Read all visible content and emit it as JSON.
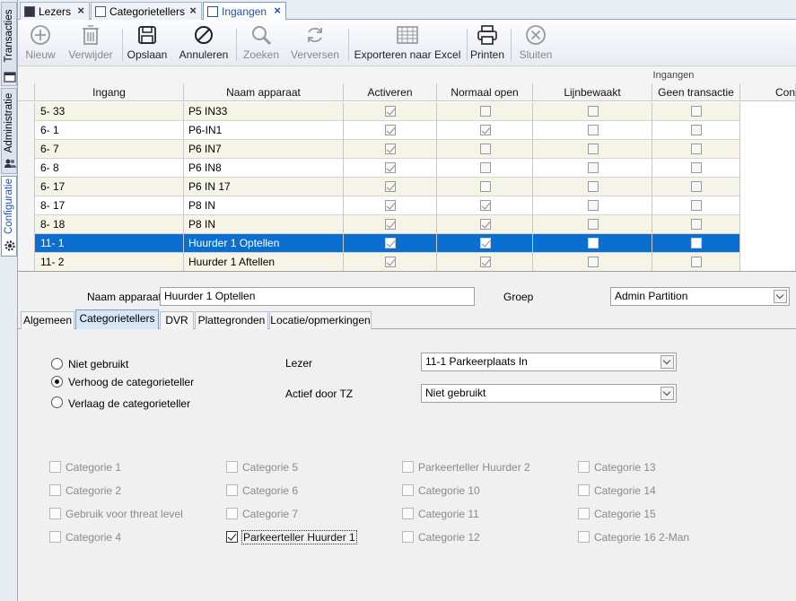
{
  "vertical_tabs": [
    {
      "label": "Transacties",
      "icon": "window-icon"
    },
    {
      "label": "Administratie",
      "icon": "users-icon"
    },
    {
      "label": "Configuratie",
      "icon": "gear-icon"
    }
  ],
  "doc_tabs": [
    {
      "label": "Lezers",
      "icon": "reader-icon"
    },
    {
      "label": "Categorietellers",
      "icon": "counter-icon"
    },
    {
      "label": "Ingangen",
      "icon": "entrance-icon"
    }
  ],
  "toolbar": {
    "nieuw": "Nieuw",
    "verwijder": "Verwijder",
    "opslaan": "Opslaan",
    "annuleren": "Annuleren",
    "zoeken": "Zoeken",
    "verversen": "Verversen",
    "exporteren": "Exporteren naar Excel",
    "printen": "Printen",
    "sluiten": "Sluiten"
  },
  "grid": {
    "group_header": "Ingangen",
    "columns": [
      "Ingang",
      "Naam apparaat",
      "Activeren",
      "Normaal open",
      "Lijnbewaakt",
      "Geen transactie",
      "Con"
    ],
    "rows": [
      {
        "ingang": "5- 33",
        "naam": "P5 IN33",
        "activeren": true,
        "normaal_open": false,
        "lijnbewaakt": false,
        "geen_transactie": false
      },
      {
        "ingang": "6- 1",
        "naam": "P6-IN1",
        "activeren": true,
        "normaal_open": true,
        "lijnbewaakt": false,
        "geen_transactie": false
      },
      {
        "ingang": "6- 7",
        "naam": "P6 IN7",
        "activeren": true,
        "normaal_open": false,
        "lijnbewaakt": false,
        "geen_transactie": false
      },
      {
        "ingang": "6- 8",
        "naam": "P6 IN8",
        "activeren": true,
        "normaal_open": false,
        "lijnbewaakt": false,
        "geen_transactie": false
      },
      {
        "ingang": "6- 17",
        "naam": "P6 IN 17",
        "activeren": true,
        "normaal_open": false,
        "lijnbewaakt": false,
        "geen_transactie": false
      },
      {
        "ingang": "8- 17",
        "naam": "P8 IN",
        "activeren": true,
        "normaal_open": true,
        "lijnbewaakt": false,
        "geen_transactie": false
      },
      {
        "ingang": "8- 18",
        "naam": "P8 IN",
        "activeren": true,
        "normaal_open": true,
        "lijnbewaakt": false,
        "geen_transactie": false
      },
      {
        "ingang": "11- 1",
        "naam": "Huurder 1 Optellen",
        "activeren": true,
        "normaal_open": true,
        "lijnbewaakt": false,
        "geen_transactie": false,
        "selected": true
      },
      {
        "ingang": "11- 2",
        "naam": "Huurder 1 Aftellen",
        "activeren": true,
        "normaal_open": true,
        "lijnbewaakt": false,
        "geen_transactie": false
      }
    ]
  },
  "detail": {
    "naam_label": "Naam apparaat",
    "naam_value": "Huurder 1 Optellen",
    "groep_label": "Groep",
    "groep_value": "Admin Partition"
  },
  "subtabs": [
    "Algemeen",
    "Categorietellers",
    "DVR",
    "Plattegronden",
    "Locatie/opmerkingen"
  ],
  "categorie": {
    "radios": [
      {
        "label": "Niet gebruikt",
        "checked": false
      },
      {
        "label": "Verhoog de categorieteller",
        "checked": true
      },
      {
        "label": "Verlaag de categorieteller",
        "checked": false
      }
    ],
    "lezer_label": "Lezer",
    "lezer_value": "11-1 Parkeerplaats In",
    "actief_label": "Actief door TZ",
    "actief_value": "Niet gebruikt",
    "checkboxes": [
      [
        "Categorie 1",
        "Categorie 2",
        "Gebruik voor threat level",
        "Categorie 4"
      ],
      [
        "Categorie 5",
        "Categorie 6",
        "Categorie 7",
        "Parkeerteller Huurder 1"
      ],
      [
        "Parkeerteller Huurder 2",
        "Categorie 10",
        "Categorie 11",
        "Categorie 12"
      ],
      [
        "Categorie 13",
        "Categorie 14",
        "Categorie 15",
        "Categorie 16 2-Man"
      ]
    ],
    "checked_item": "Parkeerteller Huurder 1"
  },
  "colors": {
    "selection": "#0a6fd1",
    "active_tab_text": "#1e4fb8",
    "odd_row": "#f5f4e6"
  }
}
